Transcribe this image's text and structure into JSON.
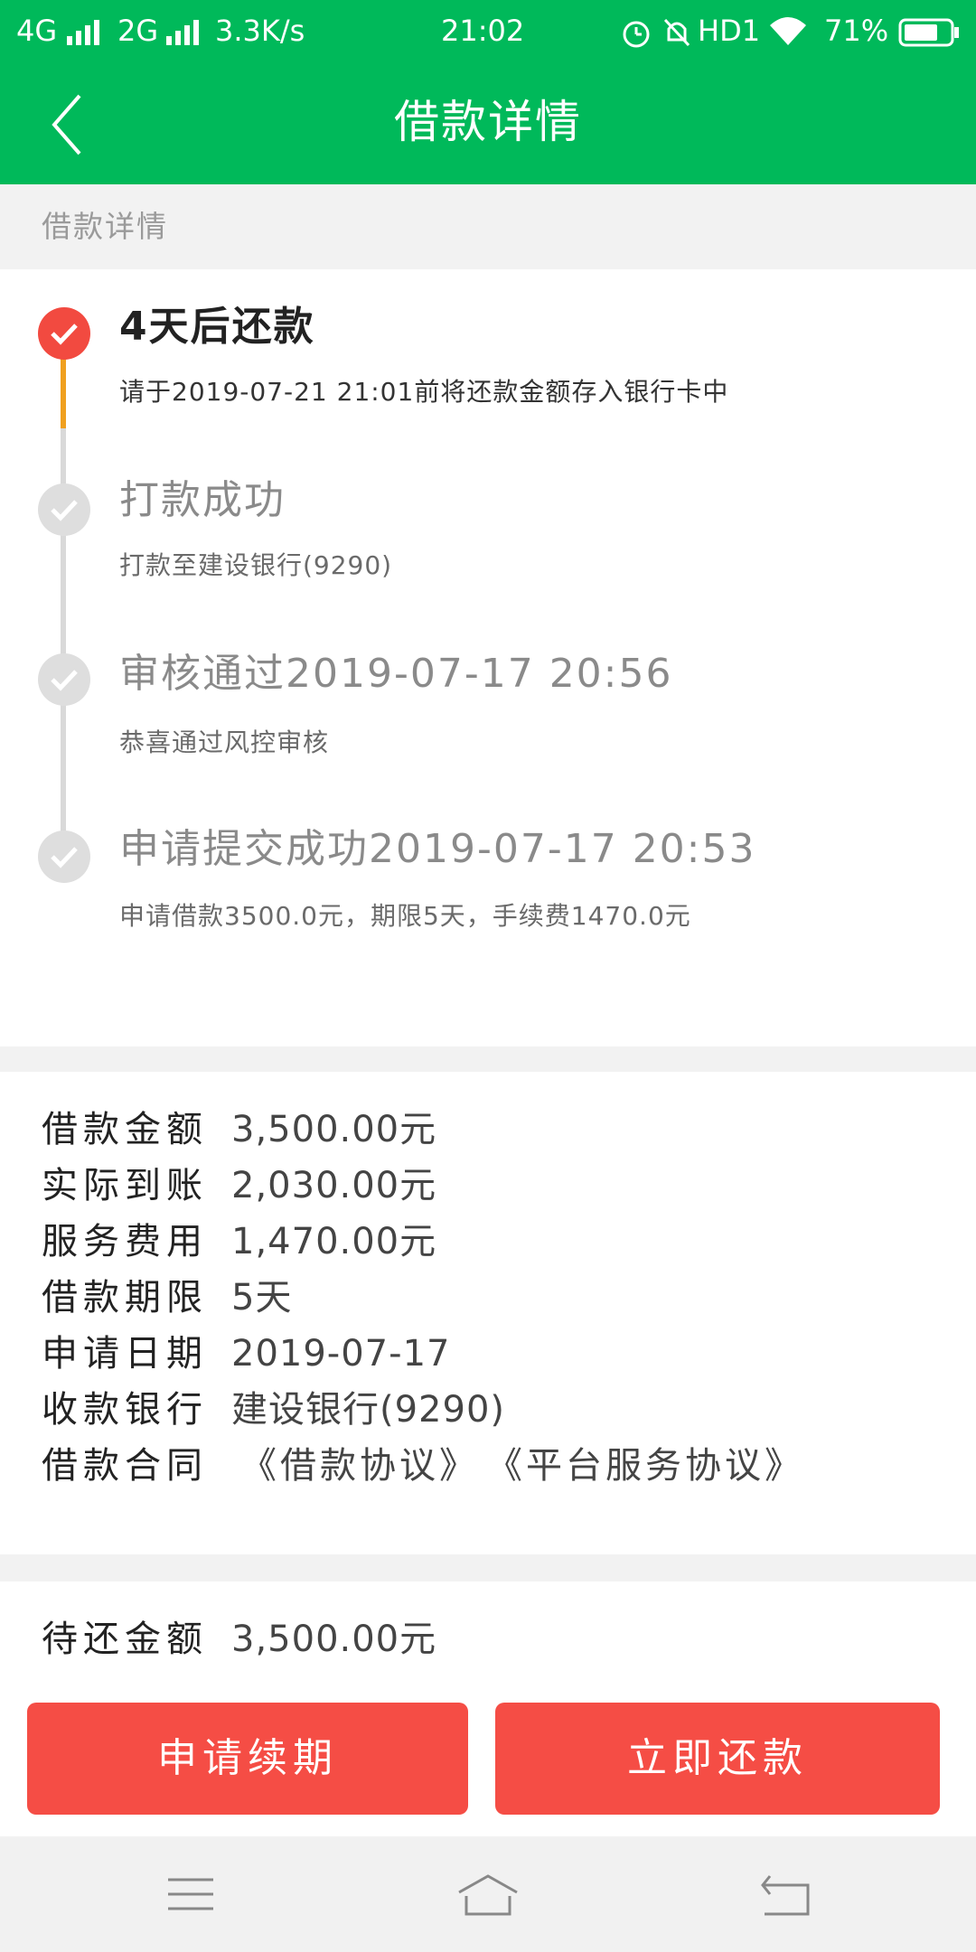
{
  "status_bar": {
    "network_1": "4G",
    "network_2": "2G",
    "speed": "3.3K/s",
    "time": "21:02",
    "hd": "HD1",
    "battery": "71%"
  },
  "header": {
    "title": "借款详情"
  },
  "section": {
    "title": "借款详情"
  },
  "timeline": [
    {
      "title": "4天后还款",
      "desc": "请于2019-07-21 21:01前将还款金额存入银行卡中",
      "active": true
    },
    {
      "title": "打款成功",
      "desc": "打款至建设银行(9290)",
      "active": false
    },
    {
      "title": "审核通过2019-07-17 20:56",
      "desc": "恭喜通过风控审核",
      "active": false
    },
    {
      "title": "申请提交成功2019-07-17 20:53",
      "desc": "申请借款3500.0元，期限5天，手续费1470.0元",
      "active": false
    }
  ],
  "details": {
    "rows": [
      {
        "label": "借款金额",
        "value": "3,500.00元"
      },
      {
        "label": "实际到账",
        "value": "2,030.00元"
      },
      {
        "label": "服务费用",
        "value": "1,470.00元"
      },
      {
        "label": "借款期限",
        "value": "5天"
      },
      {
        "label": "申请日期",
        "value": "2019-07-17"
      },
      {
        "label": "收款银行",
        "value": "建设银行(9290)"
      }
    ],
    "contract_label": "借款合同",
    "contract_links": [
      "《借款协议》",
      "《平台服务协议》"
    ]
  },
  "repay": {
    "label": "待还金额",
    "value": "3,500.00元",
    "renew_button": "申请续期",
    "repay_button": "立即还款"
  },
  "colors": {
    "brand_green": "#00b95a",
    "accent_red": "#f54d45",
    "timeline_progress": "#f0a020"
  },
  "icons": {
    "back": "chevron-left-icon",
    "check": "check-icon",
    "menu": "menu-icon",
    "home": "home-icon",
    "back_nav": "back-arrow-icon"
  }
}
